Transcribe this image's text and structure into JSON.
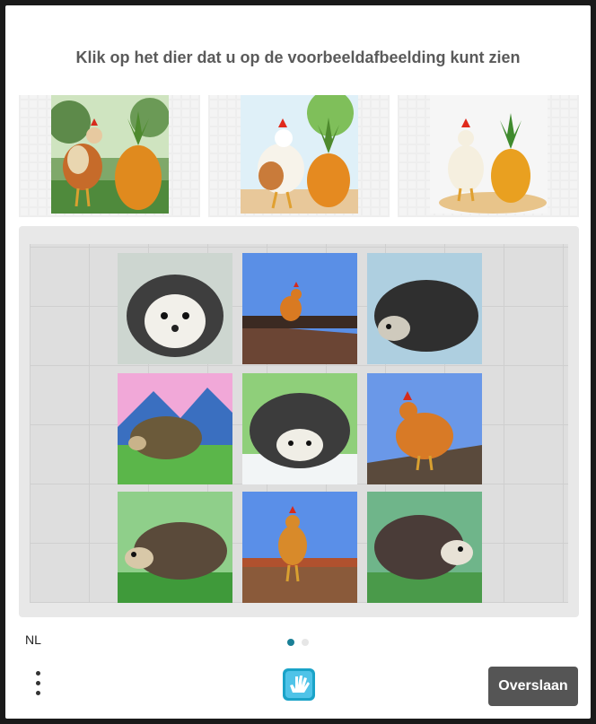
{
  "prompt": {
    "title": "Klik op het dier dat u op de voorbeeldafbeelding kunt zien"
  },
  "examples": [
    {
      "name": "rooster-and-pineapple-park"
    },
    {
      "name": "rooster-and-pineapple-cartoon"
    },
    {
      "name": "chicken-and-pineapple-sand"
    }
  ],
  "grid": [
    {
      "animal": "hedgehog",
      "style": "sketch"
    },
    {
      "animal": "chicken",
      "style": "rooftop"
    },
    {
      "animal": "hedgehog",
      "style": "dark"
    },
    {
      "animal": "hedgehog",
      "style": "watercolor-hills"
    },
    {
      "animal": "hedgehog",
      "style": "front"
    },
    {
      "animal": "chicken",
      "style": "rooftop"
    },
    {
      "animal": "hedgehog",
      "style": "grass"
    },
    {
      "animal": "chicken",
      "style": "rooftop"
    },
    {
      "animal": "hedgehog",
      "style": "side"
    }
  ],
  "footer": {
    "language": "NL",
    "skip_label": "Overslaan"
  },
  "pagination": {
    "total": 2,
    "active": 1
  },
  "colors": {
    "accent": "#1a8ba8",
    "skip_bg": "#555555",
    "title": "#5a5a5a"
  },
  "icons": {
    "menu": "more-vertical-icon",
    "brand": "hcaptcha-hand-icon"
  }
}
